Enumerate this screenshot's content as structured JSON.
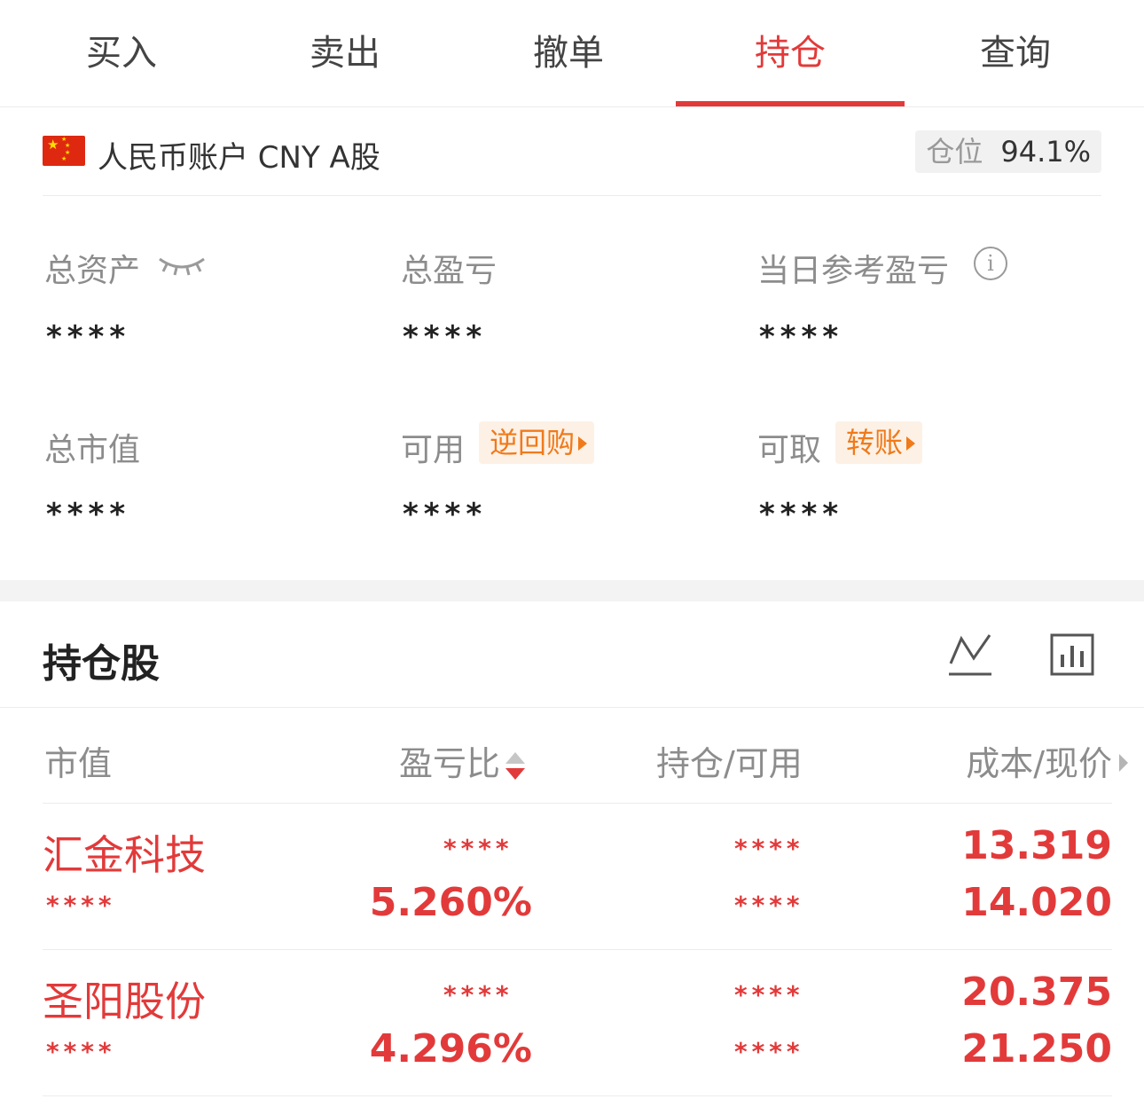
{
  "tabs": [
    {
      "label": "买入",
      "active": false
    },
    {
      "label": "卖出",
      "active": false
    },
    {
      "label": "撤单",
      "active": false
    },
    {
      "label": "持仓",
      "active": true
    },
    {
      "label": "查询",
      "active": false
    }
  ],
  "account": {
    "flag_icon": "china-flag-icon",
    "name": "人民币账户 CNY A股",
    "position_label": "仓位",
    "position_value": "94.1%"
  },
  "metrics": {
    "total_assets": {
      "label": "总资产",
      "value": "****"
    },
    "total_pnl": {
      "label": "总盈亏",
      "value": "****"
    },
    "today_pnl": {
      "label": "当日参考盈亏",
      "value": "****"
    },
    "market_value": {
      "label": "总市值",
      "value": "****"
    },
    "available": {
      "label": "可用",
      "value": "****",
      "action": "逆回购"
    },
    "withdrawable": {
      "label": "可取",
      "value": "****",
      "action": "转账"
    }
  },
  "holdings": {
    "title": "持仓股",
    "columns": [
      "市值",
      "盈亏比",
      "持仓/可用",
      "成本/现价"
    ],
    "rows": [
      {
        "name": "汇金科技",
        "market_value": "****",
        "pnl_amount": "****",
        "pnl_ratio": "5.260%",
        "position": "****",
        "available": "****",
        "cost": "13.319",
        "price": "14.020"
      },
      {
        "name": "圣阳股份",
        "market_value": "****",
        "pnl_amount": "****",
        "pnl_ratio": "4.296%",
        "position": "****",
        "available": "****",
        "cost": "20.375",
        "price": "21.250"
      }
    ]
  },
  "colors": {
    "accent": "#e23a3a",
    "orange": "#f07a1a",
    "muted": "#8c8c8c"
  }
}
